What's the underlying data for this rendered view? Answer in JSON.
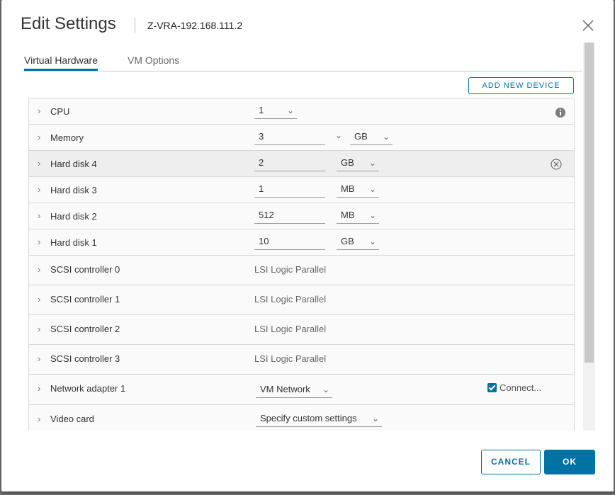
{
  "dialog": {
    "title": "Edit Settings",
    "vm_name": "Z-VRA-192.168.111.2",
    "close_icon": "close-icon"
  },
  "tabs": [
    {
      "label": "Virtual Hardware",
      "active": true
    },
    {
      "label": "VM Options",
      "active": false
    }
  ],
  "add_device_label": "ADD NEW DEVICE",
  "devices": {
    "cpu": {
      "label": "CPU",
      "value": "1"
    },
    "memory": {
      "label": "Memory",
      "value": "3",
      "unit": "GB"
    },
    "hard_disk_4": {
      "label": "Hard disk 4",
      "value": "2",
      "unit": "GB"
    },
    "hard_disk_3": {
      "label": "Hard disk 3",
      "value": "1",
      "unit": "MB"
    },
    "hard_disk_2": {
      "label": "Hard disk 2",
      "value": "512",
      "unit": "MB"
    },
    "hard_disk_1": {
      "label": "Hard disk 1",
      "value": "10",
      "unit": "GB"
    },
    "scsi_0": {
      "label": "SCSI controller 0",
      "value": "LSI Logic Parallel"
    },
    "scsi_1": {
      "label": "SCSI controller 1",
      "value": "LSI Logic Parallel"
    },
    "scsi_2": {
      "label": "SCSI controller 2",
      "value": "LSI Logic Parallel"
    },
    "scsi_3": {
      "label": "SCSI controller 3",
      "value": "LSI Logic Parallel"
    },
    "network_adapter_1": {
      "label": "Network adapter 1",
      "value": "VM Network",
      "connect_label": "Connect..."
    },
    "video_card": {
      "label": "Video card",
      "value": "Specify custom settings"
    }
  },
  "footer": {
    "cancel_label": "CANCEL",
    "ok_label": "OK"
  },
  "colors": {
    "accent": "#0072a3"
  }
}
